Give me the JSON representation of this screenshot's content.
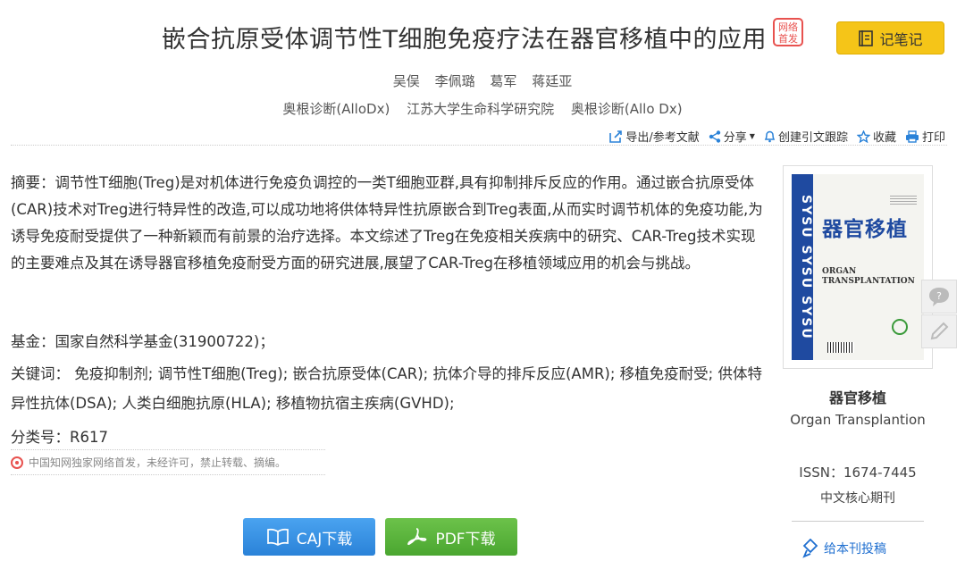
{
  "header": {
    "title": "嵌合抗原受体调节性T细胞免疫疗法在器官移植中的应用",
    "badge_line1": "网络",
    "badge_line2": "首发",
    "note_button": "记笔记"
  },
  "authors": [
    "吴俣",
    "李佩璐",
    "葛军",
    "蒋廷亚"
  ],
  "affiliations": [
    "奥根诊断(AlloDx)",
    "江苏大学生命科学研究院",
    "奥根诊断(Allo Dx)"
  ],
  "toolbar": {
    "export": "导出/参考文献",
    "share": "分享",
    "cite_track": "创建引文跟踪",
    "favorite": "收藏",
    "print": "打印"
  },
  "abstract": {
    "label": "摘要：",
    "text": "调节性T细胞(Treg)是对机体进行免疫负调控的一类T细胞亚群,具有抑制排斥反应的作用。通过嵌合抗原受体(CAR)技术对Treg进行特异性的改造,可以成功地将供体特异性抗原嵌合到Treg表面,从而实时调节机体的免疫功能,为诱导免疫耐受提供了一种新颖而有前景的治疗选择。本文综述了Treg在免疫相关疾病中的研究、CAR-Treg技术实现的主要难点及其在诱导器官移植免疫耐受方面的研究进展,展望了CAR-Treg在移植领域应用的机会与挑战。"
  },
  "fund": {
    "label": "基金：",
    "text": "国家自然科学基金(31900722)；"
  },
  "keywords": {
    "label": "关键词：",
    "items": [
      "免疫抑制剂;",
      "调节性T细胞(Treg);",
      "嵌合抗原受体(CAR);",
      "抗体介导的排斥反应(AMR);",
      "移植免疫耐受;",
      "供体特异性抗体(DSA);",
      "人类白细胞抗原(HLA);",
      "移植物抗宿主疾病(GVHD);"
    ]
  },
  "classification": {
    "label": "分类号：",
    "code": "R617"
  },
  "notice": "中国知网独家网络首发，未经许可，禁止转载、摘编。",
  "downloads": {
    "caj": "CAJ下载",
    "pdf": "PDF下载"
  },
  "journal": {
    "cover_band": "SYSU SYSU SYSU",
    "cover_title": "器官移植",
    "cover_en1": "ORGAN",
    "cover_en2": "TRANSPLANTATION",
    "name": "器官移植",
    "english_name": "Organ Transplantion",
    "issn": "ISSN：1674-7445",
    "core": "中文核心期刊",
    "submit": "给本刊投稿"
  },
  "colors": {
    "accent_yellow": "#f5c518",
    "caj_blue": "#2a82d8",
    "pdf_green": "#4aa630",
    "badge_red": "#e8524f",
    "link_blue": "#1f6fd0"
  }
}
